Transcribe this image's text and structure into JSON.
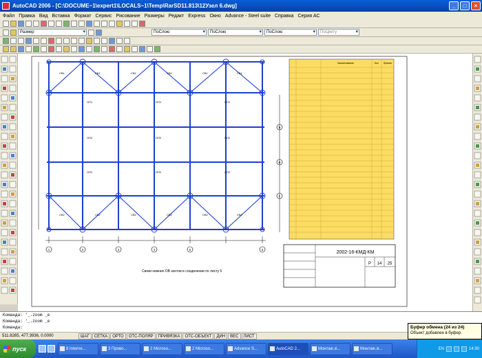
{
  "window": {
    "title": "AutoCAD 2006 - [C:\\DOCUME~1\\expert1\\LOCALS~1\\Temp\\RarSD11.813\\12Узел 6.dwg]"
  },
  "menu": [
    "Файл",
    "Правка",
    "Вид",
    "Вставка",
    "Формат",
    "Сервис",
    "Рисование",
    "Размеры",
    "Редакт",
    "Express",
    "Окно",
    "Advance - Steel suite",
    "Справка",
    "Серия АС"
  ],
  "toolbar": {
    "dimstyle": "Размер",
    "layer_color": "ПоСлою",
    "linetype": "ПоСлою",
    "lineweight": "ПоСлою",
    "plotstyle": "ПоЦвету"
  },
  "drawing": {
    "title_block_code": "2002-16-КМД-КМ",
    "sheet": "14",
    "sheets": "25",
    "stage": "Р",
    "caption": "Связи нижних ОВ зонтов в соединении по листу 5",
    "col_numbers": [
      "1",
      "2",
      "3",
      "4",
      "5",
      "6"
    ],
    "row_axes": [
      "Б",
      "В",
      "Г"
    ],
    "spec_head_1": "Наименование",
    "spec_head_2": "Кол",
    "spec_head_3": "Примеч"
  },
  "command": {
    "lines": [
      "Команда:  '_.zoom _e",
      "Команда:  '_.zoom _e",
      "Команда:"
    ]
  },
  "status": {
    "coords": "511.8265, 477.3936, 0.0000",
    "buttons": [
      "ШАГ",
      "СЕТКА",
      "ОРТО",
      "ОТС-ПОЛЯР",
      "ПРИВЯЗКА",
      "ОТС-ОБЪЕКТ",
      "ДИН",
      "ВЕС",
      "ЛИСТ"
    ]
  },
  "clipboard": {
    "title": "Буфер обмена (24 из 24)",
    "text": "Объект добавлен в буфер."
  },
  "taskbar": {
    "start": "пуск",
    "tasks": [
      "8 Interne...",
      "3 Прово...",
      "2 Microso...",
      "2 Microso...",
      "Advance S...",
      "AutoCAD 2...",
      "Монтаж.зі...",
      "Монтаж.зі..."
    ],
    "lang": "EN",
    "time": "14:30"
  }
}
